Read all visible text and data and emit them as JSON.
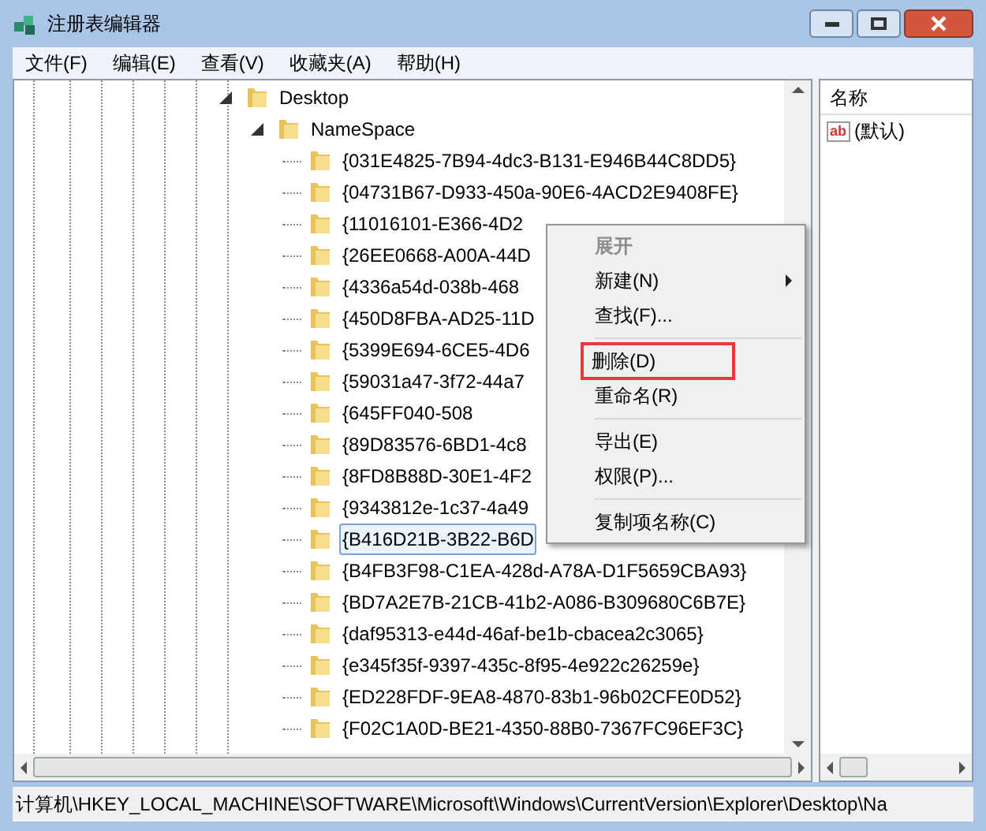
{
  "window": {
    "title": "注册表编辑器"
  },
  "menu_bar": [
    "文件(F)",
    "编辑(E)",
    "查看(V)",
    "收藏夹(A)",
    "帮助(H)"
  ],
  "tree": [
    {
      "label": "Desktop",
      "expanded": true,
      "selected": false,
      "children": [
        {
          "label": "NameSpace",
          "expanded": true,
          "selected": false,
          "children": [
            {
              "label": "{031E4825-7B94-4dc3-B131-E946B44C8DD5}",
              "selected": false
            },
            {
              "label": "{04731B67-D933-450a-90E6-4ACD2E9408FE}",
              "selected": false
            },
            {
              "label": "{11016101-E366-4D2",
              "selected": false
            },
            {
              "label": "{26EE0668-A00A-44D",
              "selected": false
            },
            {
              "label": "{4336a54d-038b-468",
              "selected": false
            },
            {
              "label": "{450D8FBA-AD25-11D",
              "selected": false
            },
            {
              "label": "{5399E694-6CE5-4D6",
              "selected": false
            },
            {
              "label": "{59031a47-3f72-44a7",
              "selected": false
            },
            {
              "label": "{645FF040-508",
              "selected": false
            },
            {
              "label": "{89D83576-6BD1-4c8",
              "selected": false
            },
            {
              "label": "{8FD8B88D-30E1-4F2",
              "selected": false
            },
            {
              "label": "{9343812e-1c37-4a49",
              "selected": false
            },
            {
              "label": "{B416D21B-3B22-B6D",
              "selected": true
            },
            {
              "label": "{B4FB3F98-C1EA-428d-A78A-D1F5659CBA93}",
              "selected": false
            },
            {
              "label": "{BD7A2E7B-21CB-41b2-A086-B309680C6B7E}",
              "selected": false
            },
            {
              "label": "{daf95313-e44d-46af-be1b-cbacea2c3065}",
              "selected": false
            },
            {
              "label": "{e345f35f-9397-435c-8f95-4e922c26259e}",
              "selected": false
            },
            {
              "label": "{ED228FDF-9EA8-4870-83b1-96b02CFE0D52}",
              "selected": false
            },
            {
              "label": "{F02C1A0D-BE21-4350-88B0-7367FC96EF3C}",
              "selected": false
            }
          ]
        }
      ]
    }
  ],
  "values_pane": {
    "column": "名称",
    "rows": [
      {
        "type_icon": "ab",
        "name": "(默认)"
      }
    ]
  },
  "context_menu": [
    {
      "kind": "item",
      "label": "展开",
      "disabled": true,
      "submenu": false,
      "highlighted": false
    },
    {
      "kind": "item",
      "label": "新建(N)",
      "disabled": false,
      "submenu": true,
      "highlighted": false
    },
    {
      "kind": "item",
      "label": "查找(F)...",
      "disabled": false,
      "submenu": false,
      "highlighted": false
    },
    {
      "kind": "separator"
    },
    {
      "kind": "item",
      "label": "删除(D)",
      "disabled": false,
      "submenu": false,
      "highlighted": true
    },
    {
      "kind": "item",
      "label": "重命名(R)",
      "disabled": false,
      "submenu": false,
      "highlighted": false
    },
    {
      "kind": "separator"
    },
    {
      "kind": "item",
      "label": "导出(E)",
      "disabled": false,
      "submenu": false,
      "highlighted": false
    },
    {
      "kind": "item",
      "label": "权限(P)...",
      "disabled": false,
      "submenu": false,
      "highlighted": false
    },
    {
      "kind": "separator"
    },
    {
      "kind": "item",
      "label": "复制项名称(C)",
      "disabled": false,
      "submenu": false,
      "highlighted": false
    }
  ],
  "status_bar": "计算机\\HKEY_LOCAL_MACHINE\\SOFTWARE\\Microsoft\\Windows\\CurrentVersion\\Explorer\\Desktop\\Na"
}
